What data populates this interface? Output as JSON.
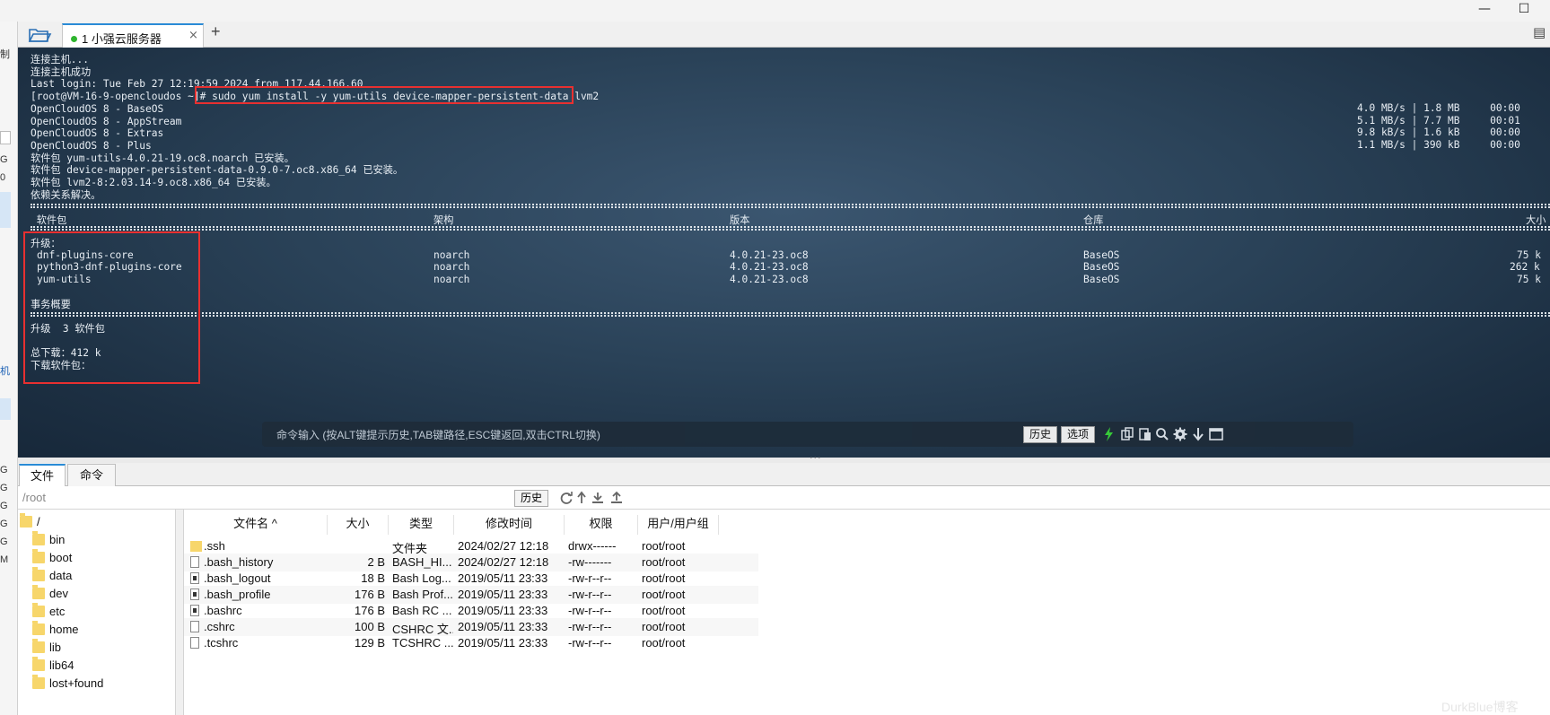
{
  "window": {
    "minimize_glyph": "—",
    "maximize_glyph": "☐"
  },
  "left_strip_fragments": [
    "制",
    "G",
    "0",
    "机",
    "G",
    "G",
    "G",
    "G",
    "G",
    "M"
  ],
  "tabs": {
    "session_label": "1 小强云服务器",
    "close_glyph": "×",
    "add_glyph": "+",
    "menu_glyph": "▤"
  },
  "terminal": {
    "lines": [
      "连接主机...",
      "连接主机成功",
      "Last login: Tue Feb 27 12:19:59 2024 from 117.44.166.60"
    ],
    "prompt": "[root@VM-16-9-opencloudos ~]# ",
    "command": "sudo yum install -y yum-utils device-mapper-persistent-data lvm2",
    "repos": [
      {
        "name": "OpenCloudOS 8 - BaseOS",
        "stats": "4.0 MB/s | 1.8 MB     00:00"
      },
      {
        "name": "OpenCloudOS 8 - AppStream",
        "stats": "5.1 MB/s | 7.7 MB     00:01"
      },
      {
        "name": "OpenCloudOS 8 - Extras",
        "stats": "9.8 kB/s | 1.6 kB     00:00"
      },
      {
        "name": "OpenCloudOS 8 - Plus",
        "stats": "1.1 MB/s | 390 kB     00:00"
      }
    ],
    "installed": [
      "软件包 yum-utils-4.0.21-19.oc8.noarch 已安装。",
      "软件包 device-mapper-persistent-data-0.9.0-7.oc8.x86_64 已安装。",
      "软件包 lvm2-8:2.03.14-9.oc8.x86_64 已安装。",
      "依赖关系解决。"
    ],
    "table_headers": {
      "package": " 软件包",
      "arch": "架构",
      "version": "版本",
      "repo": "仓库",
      "size": "大小"
    },
    "upgrade_label": "升级：",
    "packages": [
      {
        "name": "dnf-plugins-core",
        "arch": "noarch",
        "version": "4.0.21-23.oc8",
        "repo": "BaseOS",
        "size": "75 k"
      },
      {
        "name": "python3-dnf-plugins-core",
        "arch": "noarch",
        "version": "4.0.21-23.oc8",
        "repo": "BaseOS",
        "size": "262 k"
      },
      {
        "name": "yum-utils",
        "arch": "noarch",
        "version": "4.0.21-23.oc8",
        "repo": "BaseOS",
        "size": "75 k"
      }
    ],
    "summary_label": "事务概要",
    "upgrade_count": "升级  3 软件包",
    "total_download": "总下载：412 k",
    "downloading": "下载软件包："
  },
  "command_bar": {
    "placeholder": "命令输入 (按ALT键提示历史,TAB键路径,ESC键返回,双击CTRL切换)",
    "history_label": "历史",
    "options_label": "选项"
  },
  "lower_tabs": {
    "files": "文件",
    "commands": "命令"
  },
  "path_bar": {
    "path": "/root",
    "history_label": "历史"
  },
  "tree": {
    "root": "/",
    "items": [
      "bin",
      "boot",
      "data",
      "dev",
      "etc",
      "home",
      "lib",
      "lib64",
      "lost+found"
    ]
  },
  "file_table": {
    "headers": {
      "name": "文件名 ^",
      "size": "大小",
      "type": "类型",
      "mtime": "修改时间",
      "perm": "权限",
      "owner": "用户/用户组"
    },
    "rows": [
      {
        "name": ".ssh",
        "size": "",
        "type": "文件夹",
        "mtime": "2024/02/27 12:18",
        "perm": "drwx------",
        "owner": "root/root",
        "kind": "folder"
      },
      {
        "name": ".bash_history",
        "size": "2 B",
        "type": "BASH_HI...",
        "mtime": "2024/02/27 12:18",
        "perm": "-rw-------",
        "owner": "root/root",
        "kind": "file"
      },
      {
        "name": ".bash_logout",
        "size": "18 B",
        "type": "Bash Log...",
        "mtime": "2019/05/11 23:33",
        "perm": "-rw-r--r--",
        "owner": "root/root",
        "kind": "dark"
      },
      {
        "name": ".bash_profile",
        "size": "176 B",
        "type": "Bash Prof...",
        "mtime": "2019/05/11 23:33",
        "perm": "-rw-r--r--",
        "owner": "root/root",
        "kind": "dark"
      },
      {
        "name": ".bashrc",
        "size": "176 B",
        "type": "Bash RC ...",
        "mtime": "2019/05/11 23:33",
        "perm": "-rw-r--r--",
        "owner": "root/root",
        "kind": "dark"
      },
      {
        "name": ".cshrc",
        "size": "100 B",
        "type": "CSHRC 文...",
        "mtime": "2019/05/11 23:33",
        "perm": "-rw-r--r--",
        "owner": "root/root",
        "kind": "file"
      },
      {
        "name": ".tcshrc",
        "size": "129 B",
        "type": "TCSHRC ...",
        "mtime": "2019/05/11 23:33",
        "perm": "-rw-r--r--",
        "owner": "root/root",
        "kind": "file"
      }
    ]
  },
  "watermark": "DurkBlue博客",
  "colors": {
    "terminal_bg": "#2a4258",
    "highlight_red": "#e83030",
    "package_green": "#4fd84f",
    "tab_accent": "#2a8bd6"
  }
}
